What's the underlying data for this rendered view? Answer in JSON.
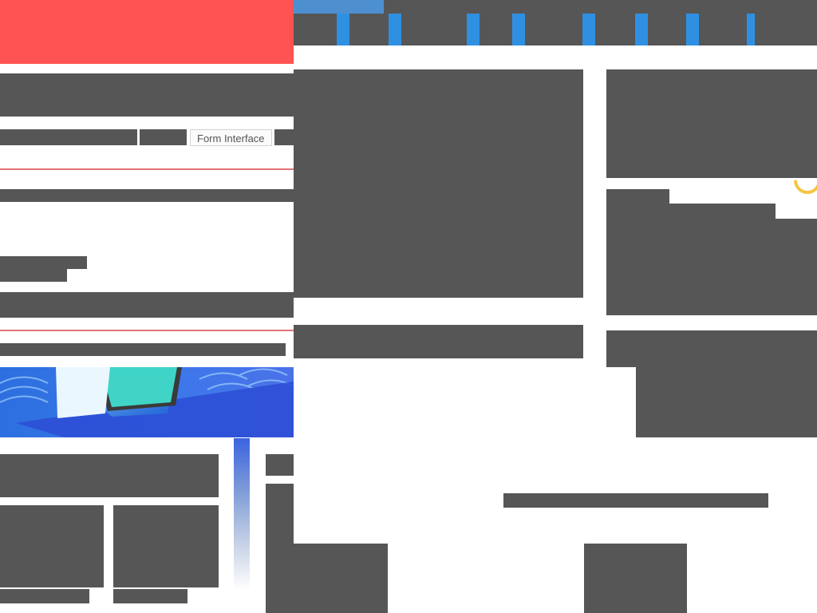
{
  "colors": {
    "hero_red": "#ff5252",
    "placeholder_gray": "#565656",
    "tab_blue": "#2f90e2",
    "accent_red": "#e57373",
    "promo_blue": "#3b78ea",
    "link_teal": "#4fc3d7",
    "ring_yellow": "#f5c542"
  },
  "tabs": {
    "active_indicator": "active-tab-bar"
  },
  "left_nav": {
    "chip_label": "Form Interface"
  },
  "promo": {
    "image": "phone-on-blue-pattern"
  },
  "icons": {
    "loader": "yellow-ring-icon"
  },
  "footer": {
    "teal_text": ""
  }
}
